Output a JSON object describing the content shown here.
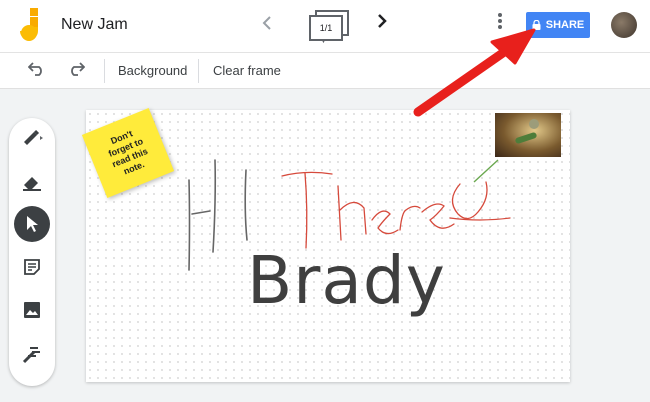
{
  "header": {
    "title": "New Jam",
    "frame_indicator": "1/1",
    "share_label": "SHARE"
  },
  "toolbar": {
    "background_label": "Background",
    "clear_frame_label": "Clear frame"
  },
  "sidebar": {
    "tools": [
      {
        "name": "pen-tool",
        "icon": "pen-icon"
      },
      {
        "name": "eraser-tool",
        "icon": "eraser-icon"
      },
      {
        "name": "select-tool",
        "icon": "pointer-icon",
        "active": true
      },
      {
        "name": "sticky-note-tool",
        "icon": "sticky-note-icon"
      },
      {
        "name": "image-tool",
        "icon": "image-icon"
      },
      {
        "name": "laser-tool",
        "icon": "laser-icon"
      }
    ]
  },
  "canvas": {
    "sticky_note_text": "Don't\nforget to\nread this\nnote.",
    "text_box": "Brady"
  },
  "colors": {
    "share_button": "#4285f4",
    "sticky_note": "#ffeb3b",
    "arrow": "#e8201c",
    "red_ink": "#d64a3c",
    "gray_ink": "#666666",
    "green_ink": "#6aa84f"
  }
}
